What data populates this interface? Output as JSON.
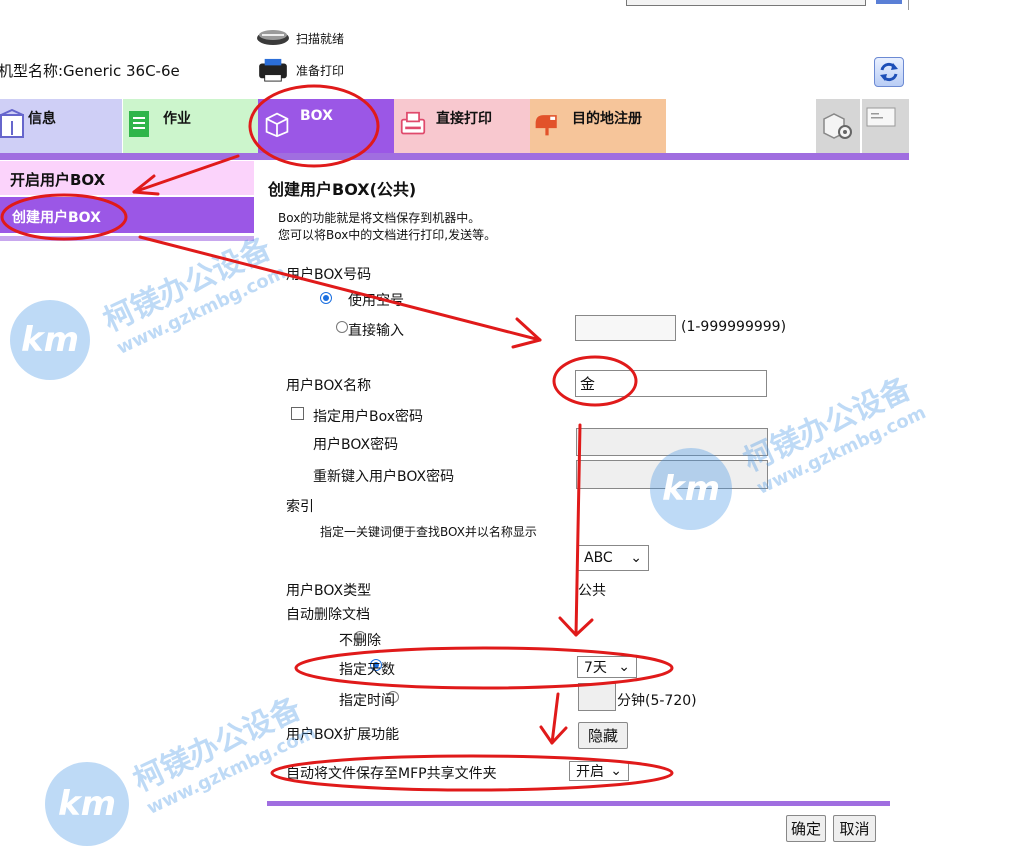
{
  "status": {
    "scan": "扫描就绪",
    "print": "准备打印",
    "model": "机型名称:Generic 36C-6e"
  },
  "tabs": [
    {
      "label": "信息",
      "bg": "#cfcff6",
      "icon_color": "#6666cc"
    },
    {
      "label": "作业",
      "bg": "#ccf5cc",
      "icon_color": "#2fb54a"
    },
    {
      "label": "BOX",
      "bg": "#9b57e6",
      "icon_color": "#ffffff"
    },
    {
      "label": "直接打印",
      "bg": "#f8c8cf",
      "icon_color": "#e04a6c"
    },
    {
      "label": "目的地注册",
      "bg": "#f6c59a",
      "icon_color": "#e2522a"
    }
  ],
  "sidebar": {
    "items": [
      {
        "label": "开启用户BOX"
      },
      {
        "label": "创建用户BOX"
      }
    ]
  },
  "page": {
    "title": "创建用户BOX(公共)",
    "desc_line1": "Box的功能就是将文档保存到机器中。",
    "desc_line2": "您可以将Box中的文档进行打印,发送等。"
  },
  "form": {
    "box_number_label": "用户BOX号码",
    "use_free_number": "使用空号",
    "direct_input": "直接输入",
    "number_range": "(1-999999999)",
    "box_name_label": "用户BOX名称",
    "box_name_value": "金",
    "specify_password": "指定用户Box密码",
    "password_label": "用户BOX密码",
    "reenter_password_label": "重新键入用户BOX密码",
    "index_label": "索引",
    "index_hint": "指定一关键词便于查找BOX并以名称显示",
    "index_value": "ABC",
    "box_type_label": "用户BOX类型",
    "box_type_value": "公共",
    "auto_delete_label": "自动删除文档",
    "no_delete": "不删除",
    "specify_days": "指定天数",
    "days_value": "7天",
    "specify_time": "指定时间",
    "minutes_range": "分钟(5-720)",
    "extension_label": "用户BOX扩展功能",
    "hide_button": "隐藏",
    "mfp_share_label": "自动将文件保存至MFP共享文件夹",
    "mfp_share_value": "开启"
  },
  "actions": {
    "ok": "确定",
    "cancel": "取消"
  },
  "watermark": {
    "brand": "柯镁办公设备",
    "url": "www.gzkmbg.com",
    "logo": "km"
  },
  "colors": {
    "accent": "#a06ee0",
    "annotation": "#e01a1a"
  }
}
